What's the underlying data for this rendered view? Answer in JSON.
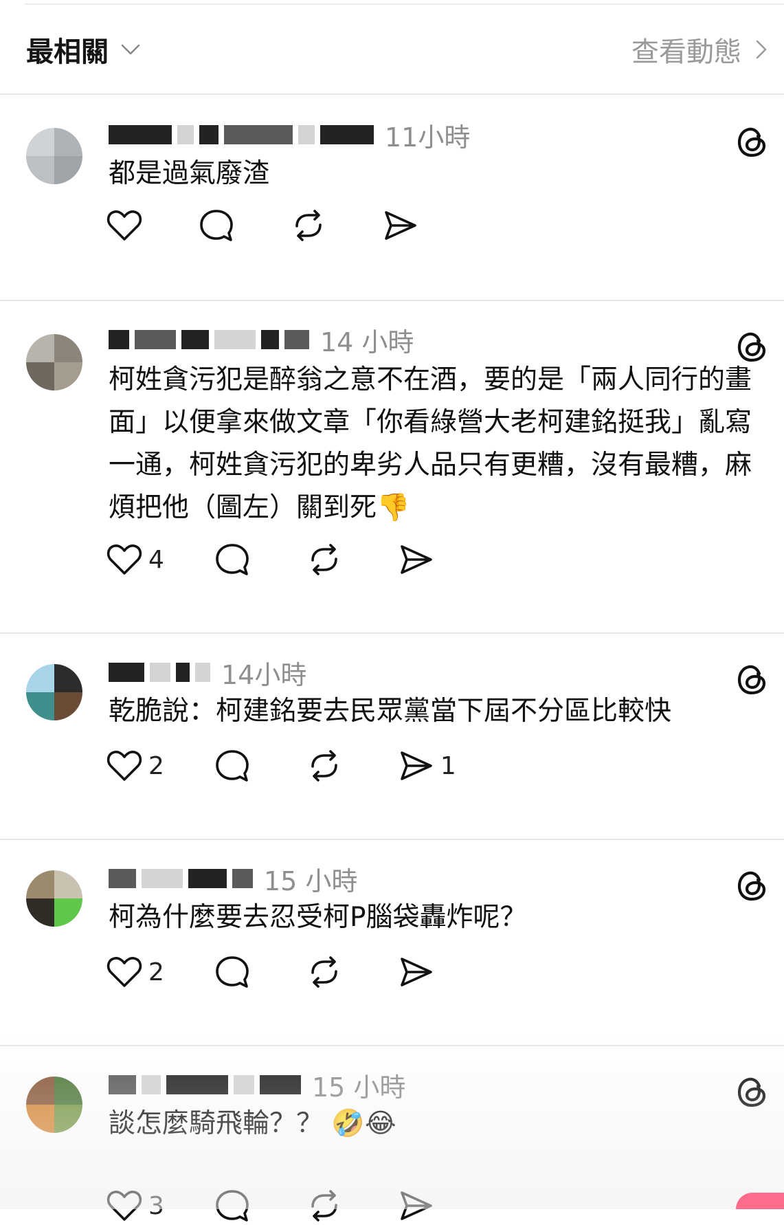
{
  "sort_bar": {
    "sort_label": "最相關",
    "activity_link": "查看動態"
  },
  "comments": [
    {
      "time": "11小時",
      "text": "都是過氣廢渣",
      "likes": "",
      "replies": "",
      "shares": ""
    },
    {
      "time": "14 小時",
      "text": "柯姓貪污犯是醉翁之意不在酒，要的是「兩人同行的畫面」以便拿來做文章「你看綠營大老柯建銘挺我」亂寫一通，柯姓貪污犯的卑劣人品只有更糟，沒有最糟，麻煩把他（圖左）關到死👎",
      "likes": "4",
      "replies": "",
      "shares": ""
    },
    {
      "time": "14小時",
      "text": "乾脆說：柯建銘要去民眾黨當下屆不分區比較快",
      "likes": "2",
      "replies": "",
      "shares": "1"
    },
    {
      "time": "15 小時",
      "text": "柯為什麼要去忍受柯P腦袋轟炸呢？",
      "likes": "2",
      "replies": "",
      "shares": ""
    },
    {
      "time": "15 小時",
      "text": "談怎麼騎飛輪？？ 🤣😂",
      "likes": "3",
      "replies": "",
      "shares": ""
    }
  ],
  "icons": {
    "sort_chevron": "chevron-down-icon",
    "activity_chevron": "chevron-right-icon",
    "threads_logo": "threads-logo-icon",
    "like": "heart-icon",
    "reply": "speech-bubble-icon",
    "repost": "repost-icon",
    "share": "send-icon"
  },
  "colors": {
    "text": "#111111",
    "muted": "#8f8f8f",
    "divider": "#e6e6e6"
  }
}
